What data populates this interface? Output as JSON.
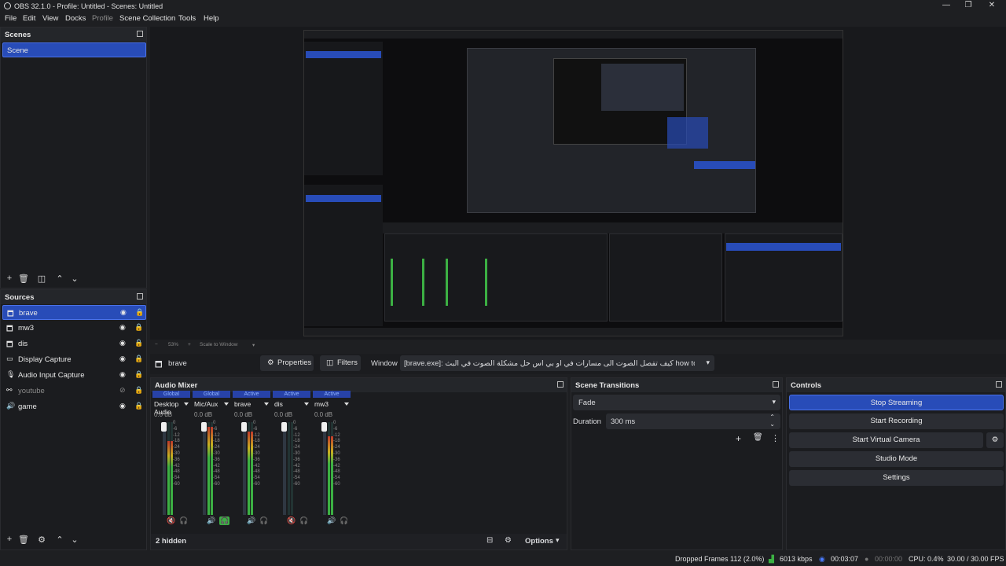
{
  "window": {
    "title": "OBS 32.1.0 - Profile: Untitled - Scenes: Untitled",
    "minimize": "—",
    "maximize": "❐",
    "close": "✕"
  },
  "menu": [
    "File",
    "Edit",
    "View",
    "Docks",
    "Profile",
    "Scene Collection",
    "Tools",
    "Help"
  ],
  "scenes": {
    "title": "Scenes",
    "items": [
      "Scene"
    ]
  },
  "sources": {
    "title": "Sources",
    "items": [
      {
        "label": "brave",
        "icon": "window-icon",
        "selected": true,
        "visible": true
      },
      {
        "label": "mw3",
        "icon": "window-icon",
        "visible": true
      },
      {
        "label": "dis",
        "icon": "window-icon",
        "visible": true
      },
      {
        "label": "Display Capture",
        "icon": "monitor-icon",
        "visible": true
      },
      {
        "label": "Audio Input Capture",
        "icon": "mic-icon",
        "visible": true
      },
      {
        "label": "youtube",
        "icon": "link-icon",
        "visible": false
      },
      {
        "label": "game",
        "icon": "speaker-icon",
        "visible": true
      }
    ]
  },
  "preview": {
    "zoom": "53%",
    "scale_mode": "Scale to Window"
  },
  "source_toolbar": {
    "source_name": "brave",
    "properties": "Properties",
    "filters": "Filters",
    "window_label": "Window",
    "window_value": "[brave.exe]: كيف تفصل الصوت الى مسارات في او بي اس حل مشكلة الصوت في البث how to separate audio in obs s"
  },
  "audio_mixer": {
    "title": "Audio Mixer",
    "hidden_label": "2 hidden",
    "options_label": "Options",
    "channels": [
      {
        "badge": "Global",
        "name": "Desktop Audio",
        "db": "0.0 dB",
        "level": 0.8,
        "muted": true
      },
      {
        "badge": "Global",
        "name": "Mic/Aux",
        "db": "0.0 dB",
        "level": 0.95,
        "muted": false
      },
      {
        "badge": "Active",
        "name": "brave",
        "db": "0.0 dB",
        "level": 0.9,
        "muted": false
      },
      {
        "badge": "Active",
        "name": "dis",
        "db": "0.0 dB",
        "level": 0.0,
        "muted": true
      },
      {
        "badge": "Active",
        "name": "mw3",
        "db": "0.0 dB",
        "level": 0.85,
        "muted": false
      }
    ],
    "scale": [
      "0",
      "-6",
      "-12",
      "-18",
      "-24",
      "-30",
      "-36",
      "-42",
      "-48",
      "-54",
      "-60"
    ]
  },
  "scene_transitions": {
    "title": "Scene Transitions",
    "transition": "Fade",
    "duration_label": "Duration",
    "duration_value": "300 ms"
  },
  "controls": {
    "title": "Controls",
    "stop_streaming": "Stop Streaming",
    "start_recording": "Start Recording",
    "start_virtual_camera": "Start Virtual Camera",
    "studio_mode": "Studio Mode",
    "settings": "Settings"
  },
  "status": {
    "dropped_frames": "Dropped Frames 112 (2.0%)",
    "bitrate": "6013 kbps",
    "stream_time": "00:03:07",
    "record_time": "00:00:00",
    "cpu": "CPU: 0.4%",
    "fps": "30.00 / 30.00 FPS"
  },
  "colors": {
    "accent": "#284cb8",
    "meter_green": "#3cb043",
    "meter_yellow": "#c8b022",
    "meter_red": "#c0392b"
  }
}
